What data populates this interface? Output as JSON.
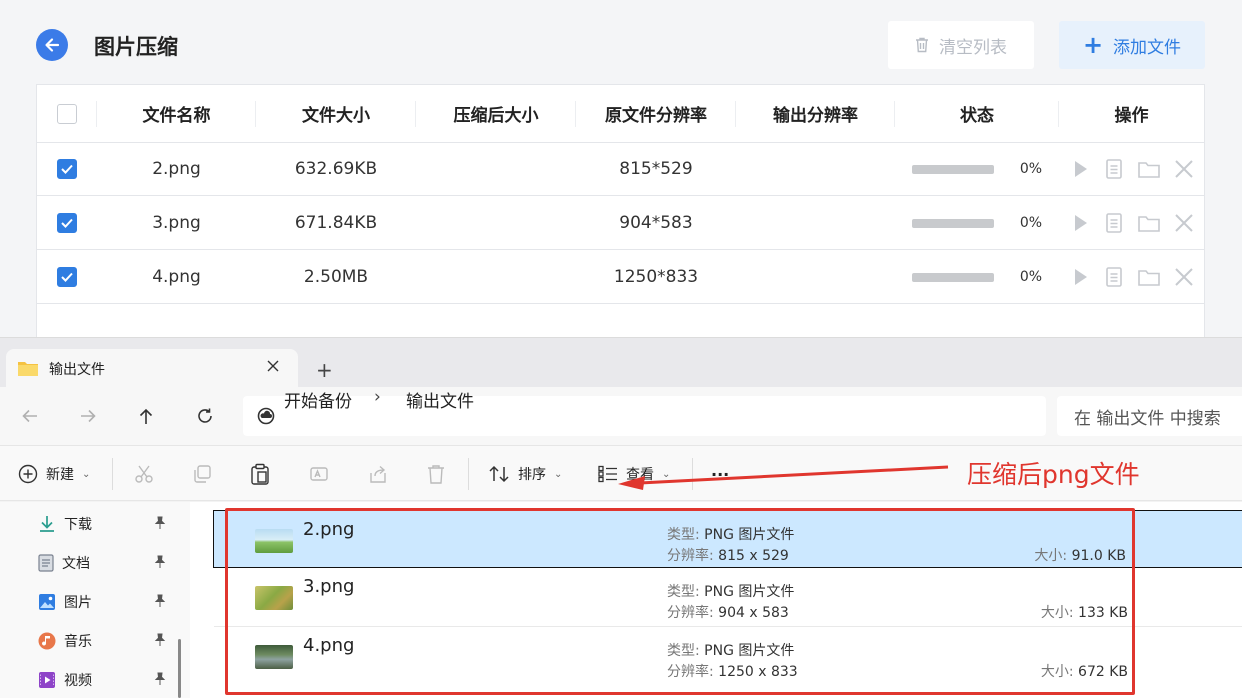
{
  "app": {
    "title": "图片压缩",
    "clear_label": "清空列表",
    "add_label": "添加文件",
    "columns": [
      "文件名称",
      "文件大小",
      "压缩后大小",
      "原文件分辨率",
      "输出分辨率",
      "状态",
      "操作"
    ],
    "rows": [
      {
        "name": "2.png",
        "size": "632.69KB",
        "compressed": "",
        "orig_res": "815*529",
        "out_res": "",
        "progress": 0,
        "progress_text": "0%",
        "checked": true
      },
      {
        "name": "3.png",
        "size": "671.84KB",
        "compressed": "",
        "orig_res": "904*583",
        "out_res": "",
        "progress": 0,
        "progress_text": "0%",
        "checked": true
      },
      {
        "name": "4.png",
        "size": "2.50MB",
        "compressed": "",
        "orig_res": "1250*833",
        "out_res": "",
        "progress": 0,
        "progress_text": "0%",
        "checked": true
      }
    ],
    "accent": "#2f7de1"
  },
  "explorer": {
    "tab_title": "输出文件",
    "breadcrumb_home": "开始备份",
    "breadcrumb_sep": "›",
    "breadcrumb_current": "输出文件",
    "search_placeholder": "在 输出文件 中搜索",
    "toolbar": {
      "new_label": "新建",
      "sort_label": "排序",
      "view_label": "查看",
      "more_label": "···"
    },
    "sidebar": [
      {
        "label": "下载",
        "icon": "download-icon"
      },
      {
        "label": "文档",
        "icon": "document-icon"
      },
      {
        "label": "图片",
        "icon": "pictures-icon"
      },
      {
        "label": "音乐",
        "icon": "music-icon"
      },
      {
        "label": "视频",
        "icon": "video-icon"
      }
    ],
    "files": [
      {
        "name": "2.png",
        "type_label": "类型:",
        "type": "PNG 图片文件",
        "res_label": "分辨率:",
        "res": "815 x 529",
        "size_label": "大小:",
        "size": "91.0 KB",
        "selected": true
      },
      {
        "name": "3.png",
        "type_label": "类型:",
        "type": "PNG 图片文件",
        "res_label": "分辨率:",
        "res": "904 x 583",
        "size_label": "大小:",
        "size": "133 KB",
        "selected": false
      },
      {
        "name": "4.png",
        "type_label": "类型:",
        "type": "PNG 图片文件",
        "res_label": "分辨率:",
        "res": "1250 x 833",
        "size_label": "大小:",
        "size": "672 KB",
        "selected": false
      }
    ]
  },
  "annotation": {
    "text": "压缩后png文件",
    "color": "#e0362e"
  }
}
